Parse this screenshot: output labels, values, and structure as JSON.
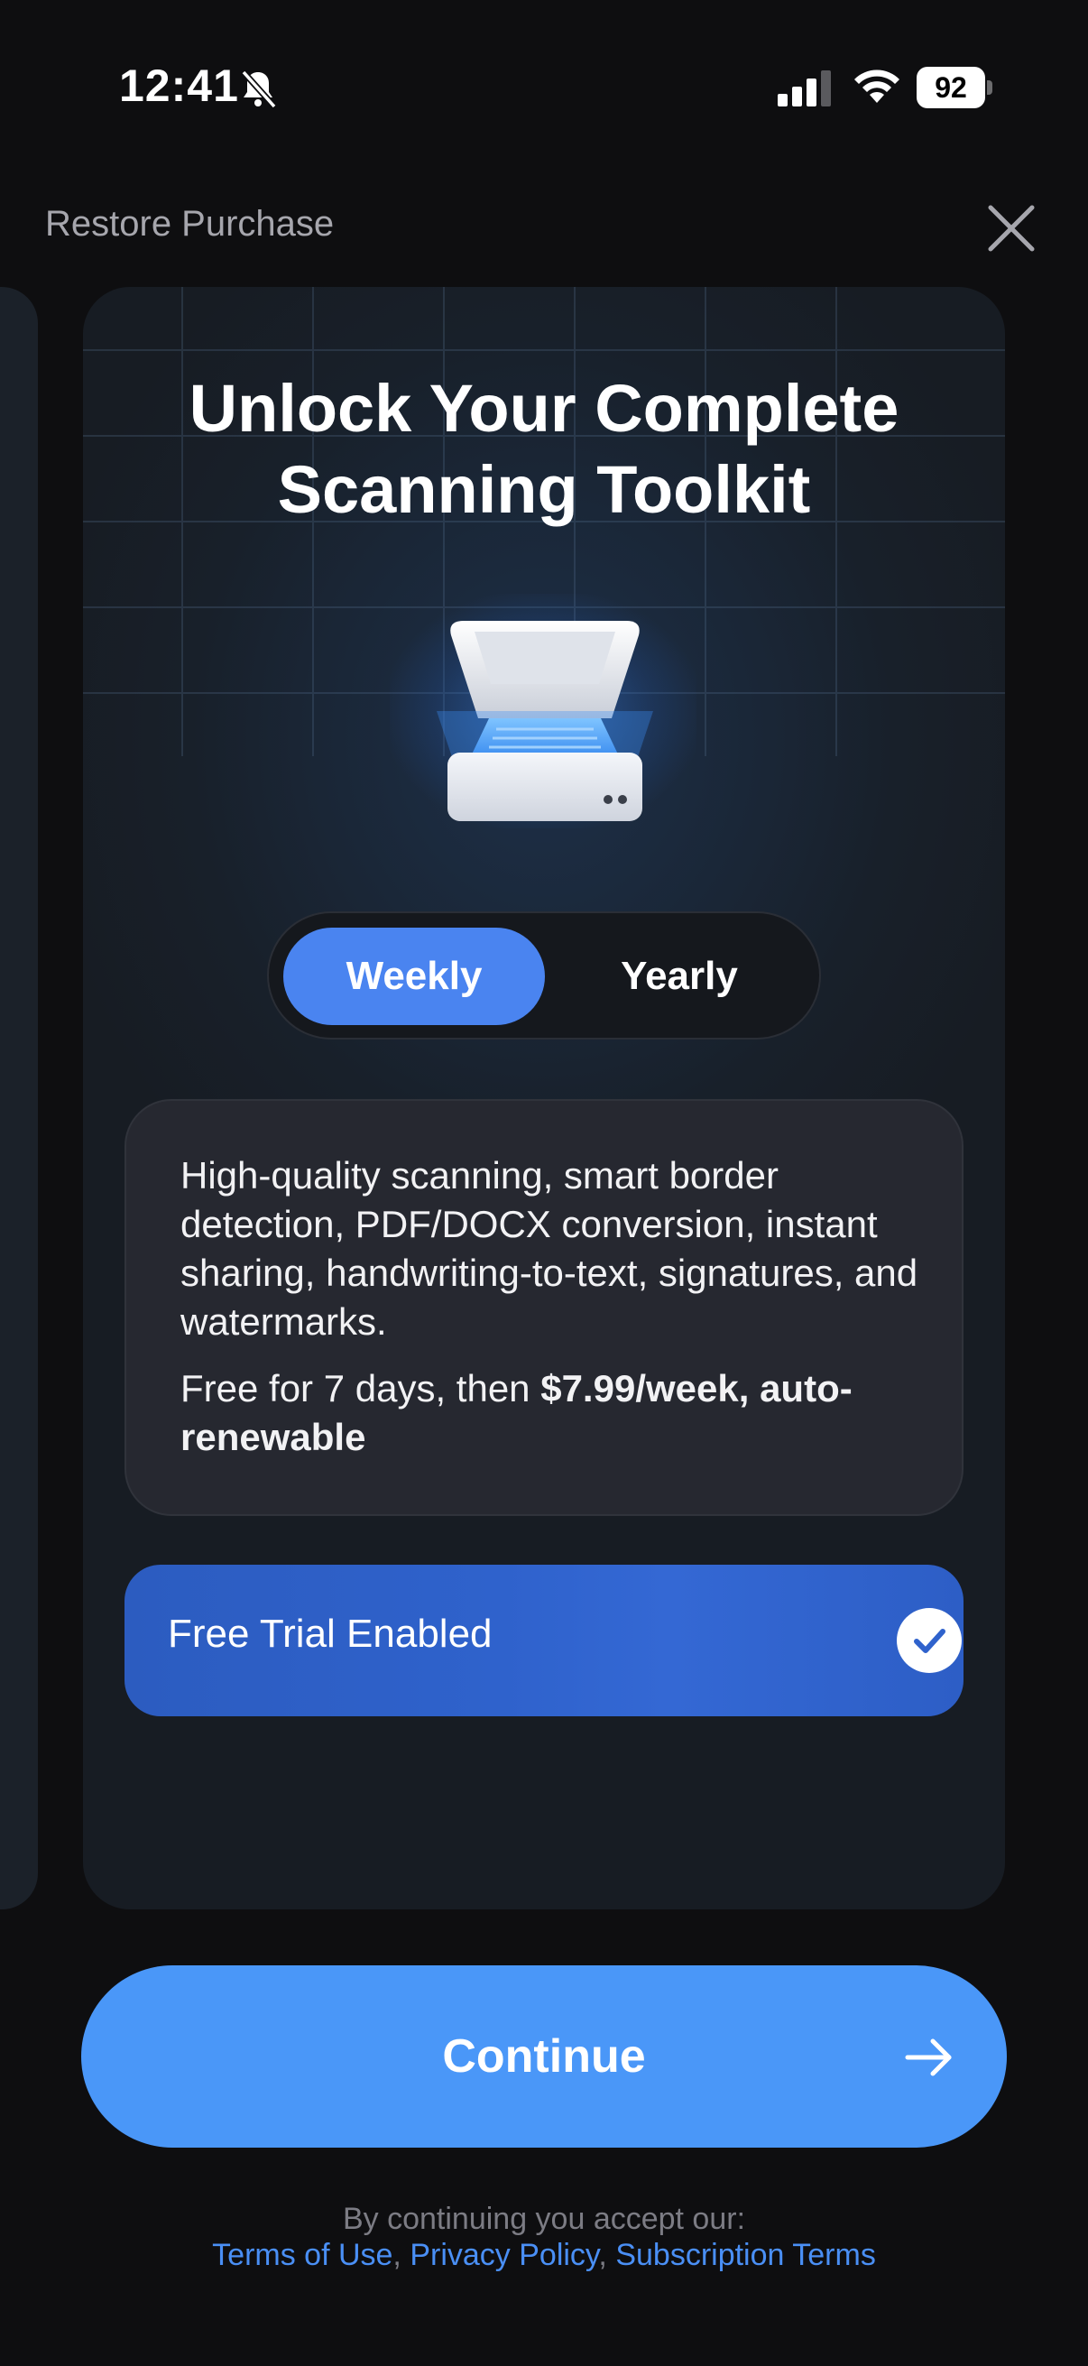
{
  "status_bar": {
    "time": "12:41",
    "battery": "92",
    "icons": [
      "bell-slash-icon",
      "signal-bars-icon",
      "wifi-icon",
      "battery-icon"
    ]
  },
  "header": {
    "restore_label": "Restore Purchase",
    "close_icon": "close-icon"
  },
  "card": {
    "title": "Unlock Your Complete Scanning Toolkit",
    "illustration": "scanner-icon",
    "segments": [
      {
        "label": "Weekly",
        "selected": true
      },
      {
        "label": "Yearly",
        "selected": false
      }
    ],
    "description": "High-quality scanning, smart border detection, PDF/DOCX conversion, instant sharing, handwriting-to-text, signatures, and watermarks.",
    "price_prefix": "Free for 7 days, then ",
    "price_bold": "$7.99/week, auto-renewable",
    "trial_label": "Free Trial Enabled",
    "trial_enabled": true
  },
  "continue": {
    "label": "Continue",
    "icon": "arrow-right-icon"
  },
  "footer": {
    "text": "By continuing you accept our:",
    "links": [
      "Terms of Use",
      "Privacy Policy",
      "Subscription Terms"
    ],
    "separator": ", "
  },
  "colors": {
    "accent": "#4a97f8",
    "segment_selected": "#4a84f0",
    "trial_bg": "#2f62cc",
    "link": "#4a8ff5"
  }
}
